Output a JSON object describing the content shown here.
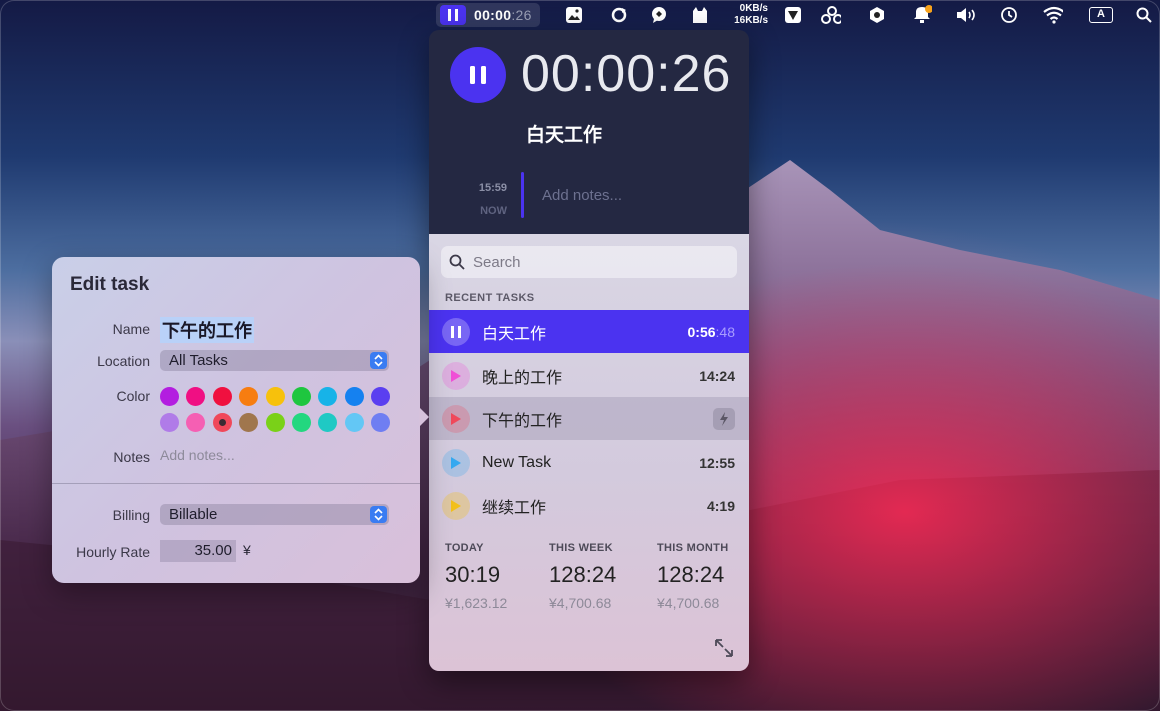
{
  "menubar": {
    "timer_main": "00:00",
    "timer_dim": ":26",
    "net_up": "0KB/s",
    "net_down": "16KB/s",
    "input_source": "A",
    "icons": [
      "pause-icon",
      "image-icon",
      "sync-icon",
      "chat-icon",
      "cat-icon",
      "kite-icon",
      "share-icon",
      "shield-icon",
      "notification-icon",
      "volume-icon",
      "time-machine-icon",
      "wifi-icon",
      "input-source-icon",
      "spotlight-icon"
    ]
  },
  "timer": {
    "elapsed": "00:00:26",
    "current_task": "白天工作",
    "start_time": "15:59",
    "now_label": "NOW",
    "notes_placeholder": "Add notes..."
  },
  "search": {
    "placeholder": "Search"
  },
  "recent": {
    "heading": "RECENT TASKS",
    "tasks": [
      {
        "name": "白天工作",
        "duration": "0:56",
        "duration_dim": ":48",
        "color": "#4b33f0",
        "state": "running"
      },
      {
        "name": "晚上的工作",
        "duration": "14:24",
        "color": "#f04fd6",
        "state": "idle"
      },
      {
        "name": "下午的工作",
        "duration": "",
        "color": "#f0485a",
        "state": "hover"
      },
      {
        "name": "New Task",
        "duration": "12:55",
        "color": "#35a9f0",
        "state": "idle"
      },
      {
        "name": "继续工作",
        "duration": "4:19",
        "color": "#f2c01a",
        "state": "idle"
      }
    ]
  },
  "stats": {
    "today": {
      "label": "TODAY",
      "time": "30:19",
      "money": "¥1,623.12"
    },
    "week": {
      "label": "THIS WEEK",
      "time": "128:24",
      "money": "¥4,700.68"
    },
    "month": {
      "label": "THIS MONTH",
      "time": "128:24",
      "money": "¥4,700.68"
    }
  },
  "edit_task": {
    "title": "Edit task",
    "name_label": "Name",
    "name_value": "下午的工作",
    "location_label": "Location",
    "location_value": "All Tasks",
    "color_label": "Color",
    "colors_row1": [
      "#b31de0",
      "#f00f83",
      "#f0103f",
      "#f77d10",
      "#f7c10c",
      "#1ec63f",
      "#17b3e8",
      "#1581f0",
      "#5a3ff0"
    ],
    "colors_row2": [
      "#b07be8",
      "#f55fb3",
      "#f0485a",
      "#a0764d",
      "#7ad118",
      "#23d77f",
      "#1fc9c4",
      "#63c7f5",
      "#6f7ef2"
    ],
    "selected_color": "#f0485a",
    "notes_label": "Notes",
    "notes_placeholder": "Add notes...",
    "billing_label": "Billing",
    "billing_value": "Billable",
    "rate_label": "Hourly Rate",
    "rate_value": "35.00",
    "currency": "¥"
  }
}
